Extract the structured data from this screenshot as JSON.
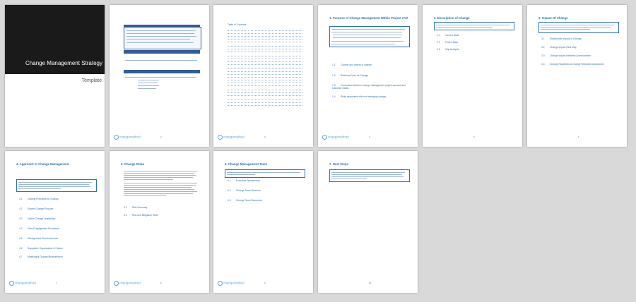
{
  "document": {
    "title": "Change Management Strategy",
    "subtitle": "Template",
    "footer_brand": "changemethod"
  },
  "pages": {
    "p2": {
      "number": "2"
    },
    "p3": {
      "number": "3",
      "toc_title": "Table of Contents"
    },
    "p4": {
      "number": "4",
      "heading": "1. Purpose of Change Management Within Project XYZ",
      "items": [
        {
          "num": "1.1",
          "label": "Context and drivers of change"
        },
        {
          "num": "1.2",
          "label": "Business Case for Change"
        },
        {
          "num": "1.3",
          "label": "Connection between change management project success and business results"
        },
        {
          "num": "1.4",
          "label": "Risks associated with not managing change"
        }
      ]
    },
    "p5": {
      "number": "5",
      "heading": "2. Description of Change",
      "items": [
        {
          "num": "2.1",
          "label": "Current State"
        },
        {
          "num": "2.2",
          "label": "Future State"
        },
        {
          "num": "2.3",
          "label": "Gap Analysis"
        }
      ]
    },
    "p6": {
      "number": "6",
      "heading": "3. Impact Of Change",
      "items": [
        {
          "num": "3.1",
          "label": "Stakeholder Impact of Change"
        },
        {
          "num": "3.2",
          "label": "Change Impact Heat Map"
        },
        {
          "num": "3.3",
          "label": "Change Impact Interview Questionnaire"
        },
        {
          "num": "3.4",
          "label": "Change Readiness & Change Resistant Assessment"
        }
      ]
    },
    "p7": {
      "number": "7",
      "heading": "4. Approach to Change Management",
      "items": [
        {
          "num": "4.1",
          "label": "Guiding Principles for Change"
        },
        {
          "num": "4.2",
          "label": "Shared Change Purpose"
        },
        {
          "num": "4.3",
          "label": "Visible Change Leadership"
        },
        {
          "num": "4.4",
          "label": "Direct Engagement Processes"
        },
        {
          "num": "4.5",
          "label": "Management Reinforcements"
        },
        {
          "num": "4.6",
          "label": "Supportive Organization & Culture"
        },
        {
          "num": "4.7",
          "label": "Meaningful Change Measurement"
        }
      ]
    },
    "p8": {
      "number": "8",
      "heading": "5. Change Risks",
      "items": [
        {
          "num": "5.1",
          "label": "Risk Summary"
        },
        {
          "num": "5.2",
          "label": "Risk and Mitigation Table"
        }
      ]
    },
    "p9": {
      "number": "9",
      "heading": "6. Change Management Team",
      "items": [
        {
          "num": "6.1",
          "label": "Executive Sponsorship"
        },
        {
          "num": "6.2",
          "label": "Change Team Structure"
        },
        {
          "num": "6.3",
          "label": "Change Team Resources"
        }
      ]
    },
    "p10": {
      "number": "10",
      "heading": "7. Next Steps"
    }
  }
}
